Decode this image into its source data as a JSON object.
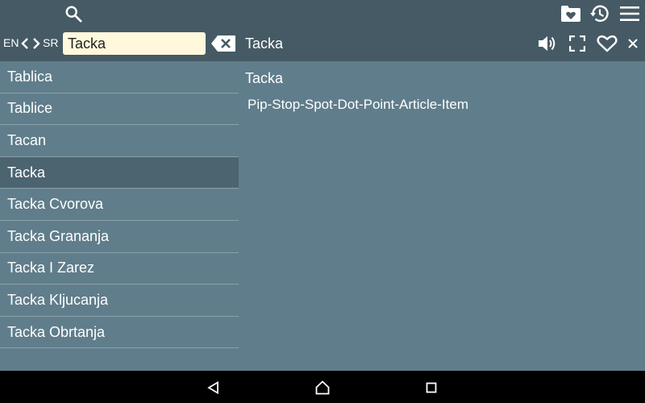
{
  "toolbar": {
    "icons": [
      "search-icon",
      "favorites-folder-icon",
      "history-icon",
      "menu-icon"
    ]
  },
  "langbar": {
    "source_lang": "EN",
    "target_lang": "SR",
    "search_value": "Tacka",
    "search_placeholder": "",
    "current_word": "Tacka",
    "icons": [
      "back-arrow-icon",
      "forward-arrow-icon",
      "clear-icon",
      "speaker-icon",
      "fullscreen-icon",
      "heart-icon",
      "close-icon"
    ]
  },
  "word_list": {
    "items": [
      "Tablica",
      "Tablice",
      "Tacan",
      "Tacka",
      "Tacka Cvorova",
      "Tacka Grananja",
      "Tacka I Zarez",
      "Tacka Kljucanja",
      "Tacka Obrtanja"
    ],
    "selected": "Tacka"
  },
  "detail": {
    "word": "Tacka",
    "definition": "Pip-Stop-Spot-Dot-Point-Article-Item"
  },
  "navbar": {
    "icons": [
      "back-nav-icon",
      "home-nav-icon",
      "recents-nav-icon"
    ]
  },
  "colors": {
    "appbar": "#455a64",
    "background": "#607d8b",
    "search_box": "#fff8dc",
    "selected_row": "#4c6470"
  }
}
